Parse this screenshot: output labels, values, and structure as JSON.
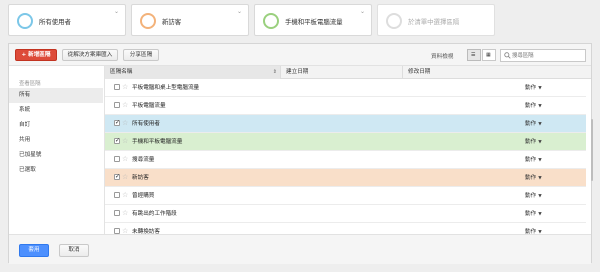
{
  "segment_chips": [
    {
      "label": "所有使用者",
      "ring_color": "#7cc7e8"
    },
    {
      "label": "新訪客",
      "ring_color": "#f3b27a"
    },
    {
      "label": "手機和平板電腦流量",
      "ring_color": "#9ad07e"
    },
    {
      "label": "於清單中選擇區隔",
      "ring_color": "#dddddd"
    }
  ],
  "toolbar": {
    "new_segment_label": "+ 新增區隔",
    "import_label": "從解決方案庫匯入",
    "share_label": "分享區隔",
    "density_label": "資料檢視",
    "search_placeholder": "搜尋區隔"
  },
  "sidebar": {
    "title": "查看區隔",
    "items": [
      {
        "label": "所有",
        "active": true
      },
      {
        "label": "系統"
      },
      {
        "label": "自訂"
      },
      {
        "label": "共用"
      },
      {
        "label": "已加星號"
      },
      {
        "label": "已選取"
      }
    ]
  },
  "table": {
    "columns": [
      "區隔名稱",
      "建立日期",
      "修改日期"
    ],
    "action_label": "動作",
    "rows": [
      {
        "name": "平板電腦和桌上型電腦流量",
        "checked": false,
        "highlight": ""
      },
      {
        "name": "平板電腦流量",
        "checked": false,
        "highlight": ""
      },
      {
        "name": "所有使用者",
        "checked": true,
        "highlight": "blue"
      },
      {
        "name": "手機和平板電腦流量",
        "checked": true,
        "highlight": "green"
      },
      {
        "name": "搜尋流量",
        "checked": false,
        "highlight": ""
      },
      {
        "name": "新訪客",
        "checked": true,
        "highlight": "orange"
      },
      {
        "name": "曾經購買",
        "checked": false,
        "highlight": ""
      },
      {
        "name": "有跳出的工作階段",
        "checked": false,
        "highlight": ""
      },
      {
        "name": "未轉換訪客",
        "checked": false,
        "highlight": ""
      }
    ]
  },
  "footer": {
    "apply_label": "套用",
    "cancel_label": "取消"
  }
}
